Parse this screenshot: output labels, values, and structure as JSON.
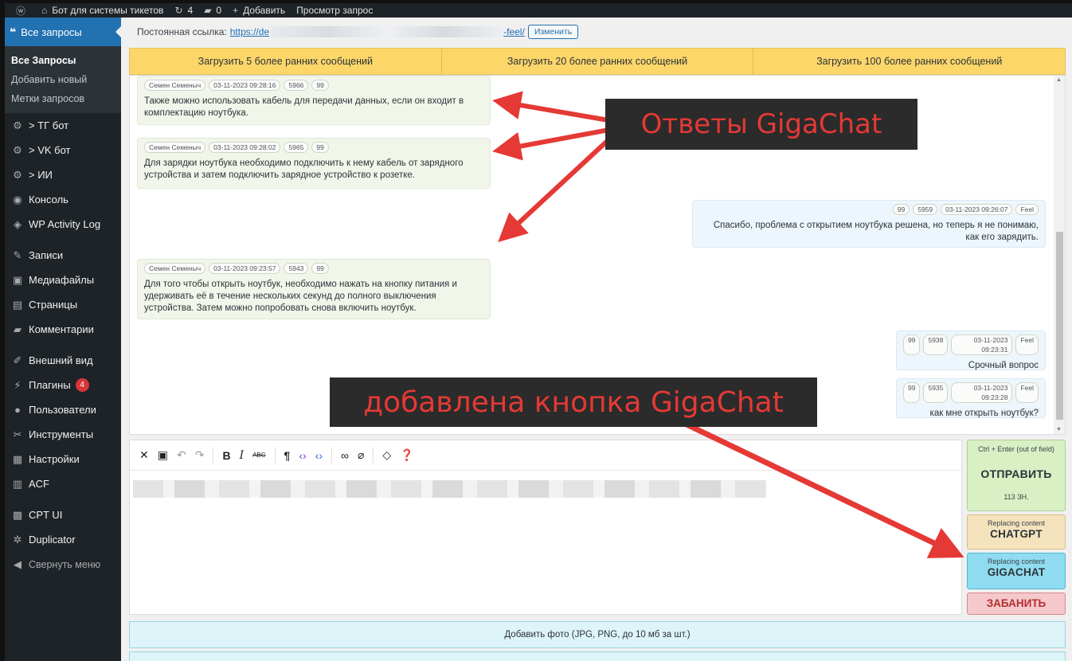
{
  "adminbar": {
    "site_name": "Бот для системы тикетов",
    "updates_count": "4",
    "comments_count": "0",
    "add_label": "Добавить",
    "view_label": "Просмотр запрос"
  },
  "sidebar": {
    "active": "Все запросы",
    "submenu": [
      "Все Запросы",
      "Добавить новый",
      "Метки запросов"
    ],
    "items_group1": [
      "> ТГ бот",
      "> VK бот",
      "> ИИ",
      "Консоль",
      "WP Activity Log"
    ],
    "items_group2": [
      "Записи",
      "Медиафайлы",
      "Страницы",
      "Комментарии"
    ],
    "items_group3": [
      "Внешний вид",
      "Плагины",
      "Пользователи",
      "Инструменты",
      "Настройки",
      "ACF"
    ],
    "plugins_badge": "4",
    "items_group4": [
      "CPT UI",
      "Duplicator"
    ],
    "collapse": "Свернуть меню"
  },
  "permalink": {
    "label": "Постоянная ссылка:",
    "url_start": "https://de",
    "url_end": "-feel/",
    "edit_button": "Изменить"
  },
  "load_buttons": [
    "Загрузить 5 более ранних сообщений",
    "Загрузить 20 более ранних сообщений",
    "Загрузить 100 более ранних сообщений"
  ],
  "messages": [
    {
      "author": "Семен Семеныч",
      "date": "03-11-2023 09:28:16",
      "id": "5966",
      "quote": "99",
      "text": "Также можно использовать кабель для передачи данных, если он входит в комплектацию ноутбука."
    },
    {
      "author": "Семен Семеныч",
      "date": "03-11-2023 09:28:02",
      "id": "5965",
      "quote": "99",
      "text": "Для зарядки ноутбука необходимо подключить к нему кабель от зарядного устройства и затем подключить зарядное устройство к розетке."
    },
    {
      "author": "Feel",
      "date": "03-11-2023 09:26:07",
      "id": "5959",
      "quote": "99",
      "text": "Спасибо, проблема с открытием ноутбука решена, но теперь я не понимаю, как его зарядить."
    },
    {
      "author": "Семен Семеныч",
      "date": "03-11-2023 09:23:57",
      "id": "5943",
      "quote": "99",
      "text": "Для того чтобы открыть ноутбук, необходимо нажать на кнопку питания и удерживать её в течение нескольких секунд до полного выключения устройства. Затем можно попробовать снова включить ноутбук."
    },
    {
      "author": "Feel",
      "date": "03-11-2023 09:23:31",
      "id": "5938",
      "quote": "99",
      "text": "Срочный вопрос"
    },
    {
      "author": "Feel",
      "date": "03-11-2023 09:23:28",
      "id": "5935",
      "quote": "99",
      "text": "как мне открыть ноутбук?"
    }
  ],
  "buttons": {
    "send_hint": "Ctrl + Enter (out of field)",
    "send": "ОТПРАВИТЬ",
    "char_count": "113 ЗН.",
    "replacing": "Replacing content",
    "chatgpt": "CHATGPT",
    "gigachat": "GIGACHAT",
    "ban": "ЗАБАНИТЬ"
  },
  "add_photo": "Добавить фото (JPG, PNG, до 10 мб за шт.)",
  "annotations": {
    "gigachat_answers": "Ответы GigaChat",
    "button_added": "добавлена кнопка GigaChat"
  },
  "colors": {
    "arrow": "#e53935",
    "wp_blue": "#2271b1",
    "sidebar": "#1d2327"
  }
}
